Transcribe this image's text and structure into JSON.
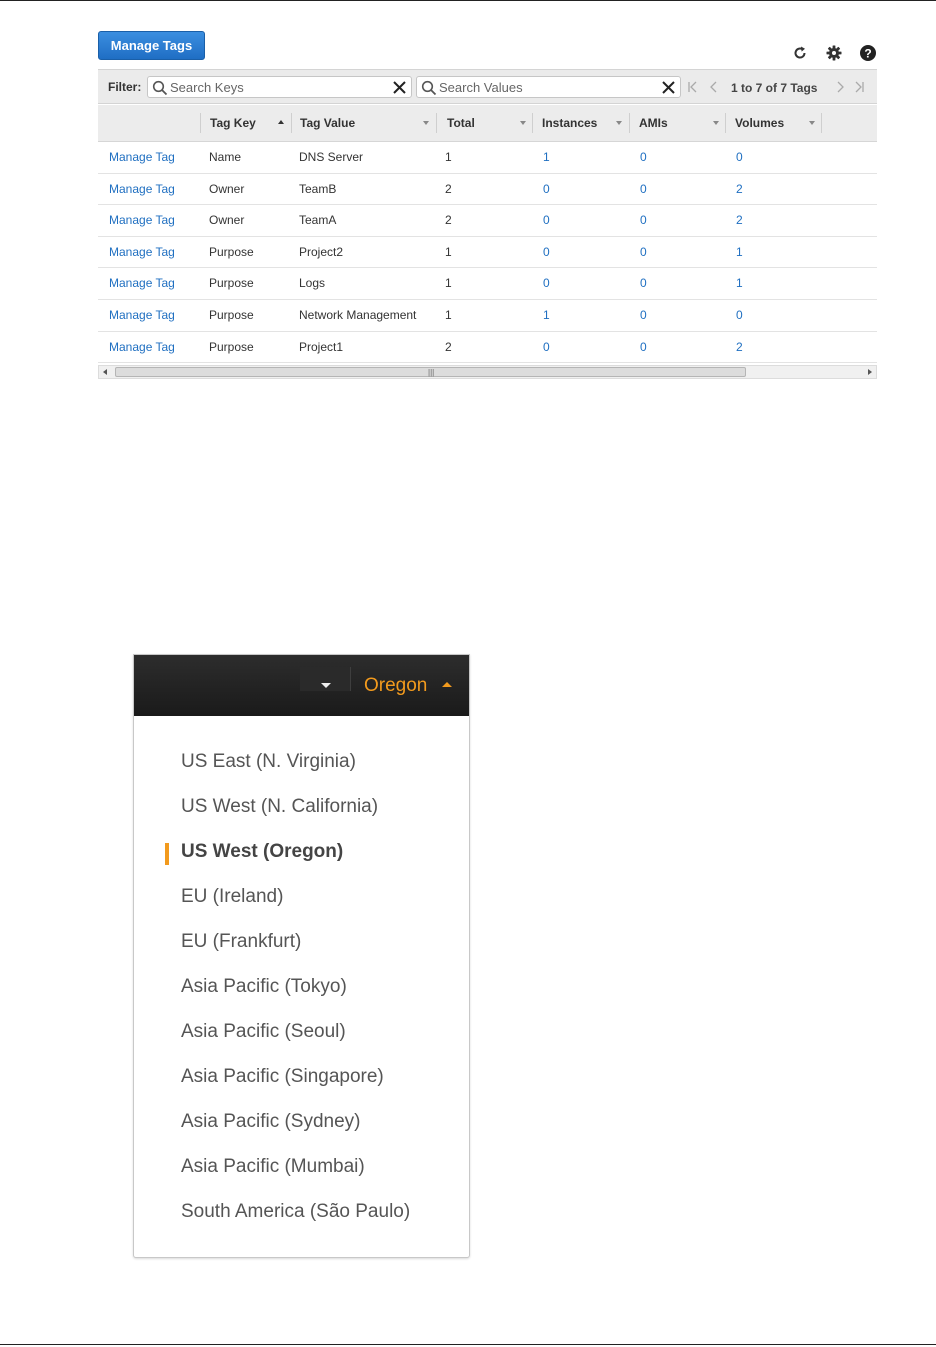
{
  "tag_editor": {
    "manage_tags_button": "Manage Tags",
    "toolbar_icons": [
      "refresh-icon",
      "gear-icon",
      "help-icon"
    ],
    "filter": {
      "label": "Filter:",
      "keys_placeholder": "Search Keys",
      "values_placeholder": "Search Values",
      "pagination_text": "1 to 7 of 7 Tags"
    },
    "columns": [
      "",
      "Tag Key",
      "Tag Value",
      "Total",
      "Instances",
      "AMIs",
      "Volumes"
    ],
    "rows": [
      {
        "action": "Manage Tag",
        "key": "Name",
        "value": "DNS Server",
        "total": "1",
        "instances": "1",
        "amis": "0",
        "volumes": "0"
      },
      {
        "action": "Manage Tag",
        "key": "Owner",
        "value": "TeamB",
        "total": "2",
        "instances": "0",
        "amis": "0",
        "volumes": "2"
      },
      {
        "action": "Manage Tag",
        "key": "Owner",
        "value": "TeamA",
        "total": "2",
        "instances": "0",
        "amis": "0",
        "volumes": "2"
      },
      {
        "action": "Manage Tag",
        "key": "Purpose",
        "value": "Project2",
        "total": "1",
        "instances": "0",
        "amis": "0",
        "volumes": "1"
      },
      {
        "action": "Manage Tag",
        "key": "Purpose",
        "value": "Logs",
        "total": "1",
        "instances": "0",
        "amis": "0",
        "volumes": "1"
      },
      {
        "action": "Manage Tag",
        "key": "Purpose",
        "value": "Network Management",
        "total": "1",
        "instances": "1",
        "amis": "0",
        "volumes": "0"
      },
      {
        "action": "Manage Tag",
        "key": "Purpose",
        "value": "Project1",
        "total": "2",
        "instances": "0",
        "amis": "0",
        "volumes": "2"
      }
    ],
    "link_color": "#1f6fc1",
    "button_color": "#1f6ec4"
  },
  "region_menu": {
    "current_region": "Oregon",
    "accent_color": "#f29a1d",
    "selected_index": 2,
    "regions": [
      "US East (N. Virginia)",
      "US West (N. California)",
      "US West (Oregon)",
      "EU (Ireland)",
      "EU (Frankfurt)",
      "Asia Pacific (Tokyo)",
      "Asia Pacific (Seoul)",
      "Asia Pacific (Singapore)",
      "Asia Pacific (Sydney)",
      "Asia Pacific (Mumbai)",
      "South America (São Paulo)"
    ]
  }
}
